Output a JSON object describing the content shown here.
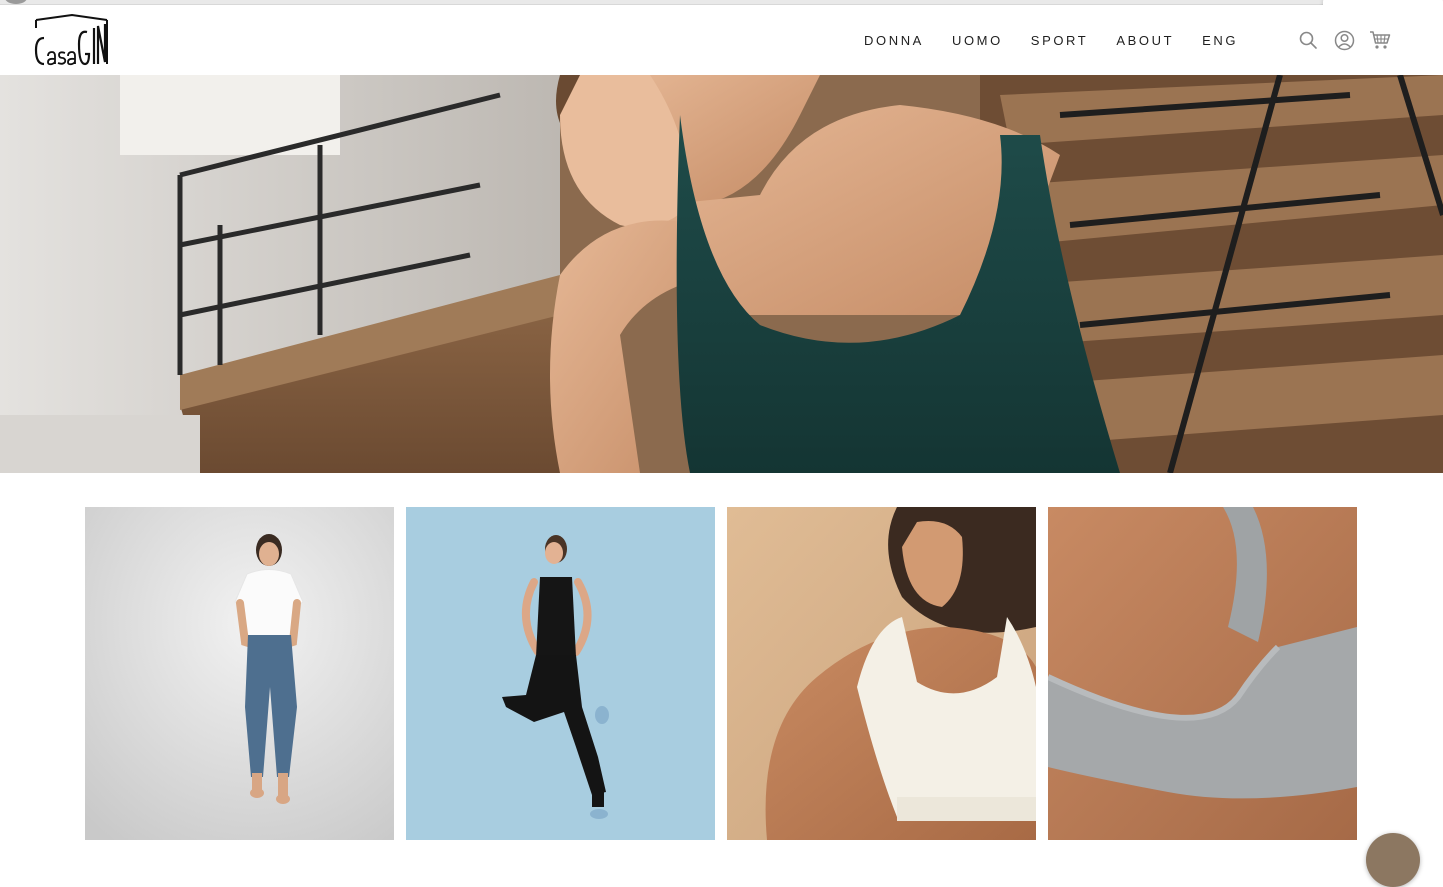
{
  "brand": {
    "logo_text": "CasaGIN"
  },
  "nav": {
    "items": [
      {
        "label": "DONNA"
      },
      {
        "label": "UOMO"
      },
      {
        "label": "SPORT"
      },
      {
        "label": "ABOUT"
      },
      {
        "label": "ENG"
      }
    ]
  },
  "header_icons": [
    "search-icon",
    "account-icon",
    "cart-icon"
  ],
  "hero": {
    "image": "woman in dark green tank top resting chin on hand beside wooden staircase"
  },
  "tiles": [
    {
      "image": "woman in white t-shirt and jeans on grey backdrop"
    },
    {
      "image": "woman in black tank top and joggers balancing on one leg, light blue backdrop"
    },
    {
      "image": "woman in cream sports bra, warm beige backdrop"
    },
    {
      "image": "back view of grey melange bra top"
    }
  ],
  "colors": {
    "nav_text": "#1f1f1f",
    "header_bg": "#ffffff",
    "tile_blue": "#a8cde0",
    "tile_beige": "#d9b48c"
  }
}
